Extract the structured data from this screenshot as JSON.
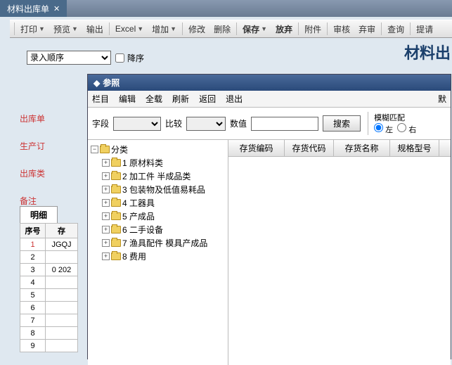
{
  "window": {
    "tab_title": "材料出库单"
  },
  "toolbar": {
    "print": "打印",
    "preview": "预览",
    "output": "输出",
    "excel": "Excel",
    "add": "增加",
    "modify": "修改",
    "delete": "删除",
    "save": "保存",
    "cancel": "放弃",
    "attach": "附件",
    "audit": "审核",
    "unaudit": "弃审",
    "query": "查询",
    "submit": "提请"
  },
  "page_title": "材料出",
  "order": {
    "select_label": "录入顺序",
    "desc_label": "降序"
  },
  "left_labels": {
    "a": "出库单",
    "b": "生产订",
    "c": "出库类",
    "d": "备注"
  },
  "detail": {
    "tab": "明细",
    "cols": {
      "idx": "序号",
      "inv": "存",
      "inv2": "存"
    },
    "rows": [
      {
        "idx": "1",
        "inv": "JGQJ"
      },
      {
        "idx": "2",
        "inv": ""
      },
      {
        "idx": "3",
        "inv": "0 202"
      },
      {
        "idx": "4",
        "inv": ""
      },
      {
        "idx": "5",
        "inv": ""
      },
      {
        "idx": "6",
        "inv": ""
      },
      {
        "idx": "7",
        "inv": ""
      },
      {
        "idx": "8",
        "inv": ""
      },
      {
        "idx": "9",
        "inv": ""
      }
    ]
  },
  "dialog": {
    "title": "参照",
    "menu": {
      "col": "栏目",
      "edit": "编辑",
      "all": "全载",
      "refresh": "刷新",
      "back": "返回",
      "exit": "退出",
      "def": "默"
    },
    "search": {
      "field_lbl": "字段",
      "cmp_lbl": "比较",
      "val_lbl": "数值",
      "btn": "搜索",
      "match_lbl": "模糊匹配",
      "left": "左",
      "right": "右"
    },
    "tree": {
      "root": "分类",
      "items": [
        {
          "code": "1",
          "name": "原材料类"
        },
        {
          "code": "2",
          "name": "加工件 半成品类"
        },
        {
          "code": "3",
          "name": "包装物及低值易耗品"
        },
        {
          "code": "4",
          "name": "工器具"
        },
        {
          "code": "5",
          "name": "产成品"
        },
        {
          "code": "6",
          "name": "二手设备"
        },
        {
          "code": "7",
          "name": "渔具配件 模具产成品"
        },
        {
          "code": "8",
          "name": "费用"
        }
      ]
    },
    "list_cols": {
      "code": "存货编码",
      "alias": "存货代码",
      "name": "存货名称",
      "spec": "规格型号"
    }
  }
}
